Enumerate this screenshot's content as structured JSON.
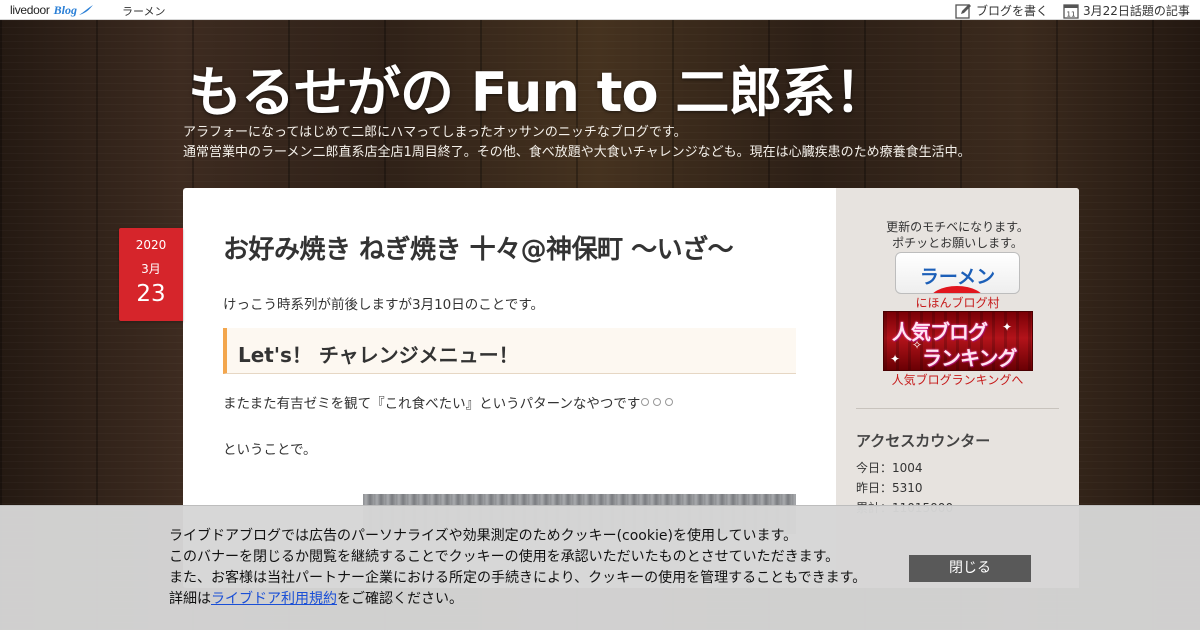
{
  "topbar": {
    "brand_livedoor": "livedoor",
    "brand_blog": "Blog",
    "category": "ラーメン",
    "write_label": "ブログを書く",
    "calendar_day": "11",
    "topic_label": "3月22日話題の記事"
  },
  "header": {
    "title": "もるせがの Fun to 二郎系！",
    "description": [
      "アラフォーになってはじめて二郎にハマってしまったオッサンのニッチなブログです。",
      "通常営業中のラーメン二郎直系店全店1周目終了。その他、食べ放題や大食いチャレンジなども。現在は心臓疾患のため療養食生活中。"
    ]
  },
  "post_date": {
    "year": "2020",
    "month": "3月",
    "day": "23"
  },
  "article": {
    "title": "お好み焼き ねぎ焼き 十々@神保町 〜いざ〜",
    "intro": "けっこう時系列が前後しますが3月10日のことです。",
    "section_heading": "Let's！ チャレンジメニュー！",
    "para1": "またまた有吉ゼミを観て『これ食べたい』というパターンなやつです",
    "para2": "ということで。"
  },
  "sidebar": {
    "message_line1": "更新のモチベになります。",
    "message_line2": "ポチッとお願いします。",
    "ramen_button_label": "ラーメン",
    "nihon_link": "にほんブログ村",
    "ranking_banner_line1": "人気ブログ",
    "ranking_banner_line2": "ランキング",
    "ranking_link": "人気ブログランキングへ",
    "counter_title": "アクセスカウンター",
    "counter": [
      {
        "label": "今日：1004"
      },
      {
        "label": "昨日：5310"
      },
      {
        "label": "累計：11015000"
      }
    ]
  },
  "cookie": {
    "line1": "ライブドアブログでは広告のパーソナライズや効果測定のためクッキー(cookie)を使用しています。",
    "line2": "このバナーを閉じるか閲覧を継続することでクッキーの使用を承認いただいたものとさせていただきます。",
    "line3": "また、お客様は当社パートナー企業における所定の手続きにより、クッキーの使用を管理することもできます。",
    "line4_prefix": "詳細は",
    "line4_link": "ライブドア利用規約",
    "line4_suffix": "をご確認ください。",
    "close_label": "閉じる"
  },
  "colors": {
    "date_badge": "#d6252b",
    "section_accent": "#f3a64d",
    "link_red": "#c61a1a",
    "cookie_link": "#1a4fd6",
    "close_button": "#595959"
  }
}
